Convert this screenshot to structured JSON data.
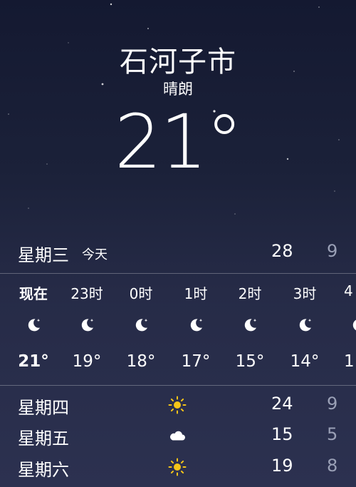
{
  "location": {
    "city": "石河子市",
    "condition": "晴朗",
    "temperature": "21°"
  },
  "today": {
    "day": "星期三",
    "label": "今天",
    "high": "28",
    "low": "9"
  },
  "hourly": [
    {
      "time": "现在",
      "icon": "moon-icon",
      "temp": "21°"
    },
    {
      "time": "23时",
      "icon": "moon-icon",
      "temp": "19°"
    },
    {
      "time": "0时",
      "icon": "moon-icon",
      "temp": "18°"
    },
    {
      "time": "1时",
      "icon": "moon-icon",
      "temp": "17°"
    },
    {
      "time": "2时",
      "icon": "moon-icon",
      "temp": "15°"
    },
    {
      "time": "3时",
      "icon": "moon-icon",
      "temp": "14°"
    },
    {
      "time": "4",
      "icon": "moon-icon",
      "temp": "1"
    }
  ],
  "daily": [
    {
      "day": "星期四",
      "icon": "sun-icon",
      "high": "24",
      "low": "9"
    },
    {
      "day": "星期五",
      "icon": "cloud-icon",
      "high": "15",
      "low": "5"
    },
    {
      "day": "星期六",
      "icon": "sun-icon",
      "high": "19",
      "low": "8"
    }
  ],
  "colors": {
    "sun": "#f5c518",
    "secondary_text": "#9aa0b6",
    "background_top": "#141931",
    "background_bottom": "#2c3150"
  }
}
